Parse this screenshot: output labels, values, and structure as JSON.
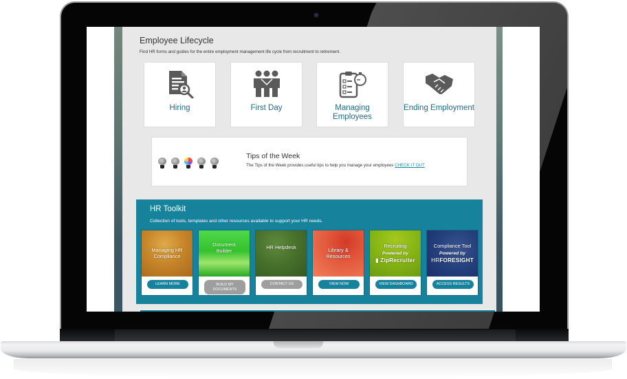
{
  "lifecycle": {
    "title": "Employee Lifecycle",
    "description": "Find HR forms and guides for the entire employment management life cycle from recruitment to retirement.",
    "cards": [
      {
        "label": "Hiring",
        "icon": "document-search-icon"
      },
      {
        "label": "First Day",
        "icon": "people-group-icon"
      },
      {
        "label": "Managing Employees",
        "icon": "clipboard-stopwatch-icon"
      },
      {
        "label": "Ending Employment",
        "icon": "handshake-icon"
      }
    ]
  },
  "tips": {
    "title": "Tips of the Week",
    "text": "The Tips of the Week provides useful tips to help you manage your employees",
    "link": "CHECK IT OUT",
    "icon": "lightbulbs-icon"
  },
  "toolkit": {
    "title": "HR Toolkit",
    "description": "Collection of tools, templates and other resources available to support your HR needs.",
    "cards": [
      {
        "title": "Managing HR Compliance",
        "button": "LEARN MORE",
        "button_style": "teal"
      },
      {
        "title": "Document Builder",
        "button": "BUILD MY DOCUMENTS",
        "button_style": "gray"
      },
      {
        "title": "HR Helpdesk",
        "button": "CONTACT US",
        "button_style": "gray"
      },
      {
        "title": "Library & Resources",
        "button": "VIEW NOW",
        "button_style": "teal"
      },
      {
        "title": "Recruiting",
        "powered": "Powered by",
        "brand": "ZipRecruiter",
        "button": "VIEW DASHBOARD",
        "button_style": "teal"
      },
      {
        "title": "Compliance Tool",
        "powered": "Powered by",
        "brand_light": "HR",
        "brand": "FORESIGHT",
        "button": "ACCESS RESULTS",
        "button_style": "teal"
      }
    ]
  },
  "colors": {
    "accent": "#17829c",
    "link": "#1e6c84",
    "panel_bg": "#e8e8e8",
    "disabled_button": "#9e9e9e"
  }
}
